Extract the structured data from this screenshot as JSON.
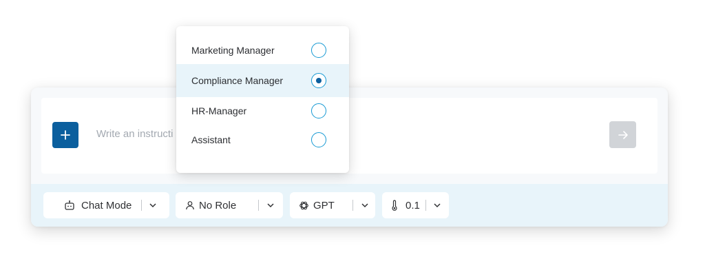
{
  "composer": {
    "placeholder": "Write an instructi",
    "add_icon": "plus-icon",
    "send_icon": "arrow-right-icon"
  },
  "toolbar": {
    "mode": {
      "label": "Chat Mode",
      "icon": "robot-icon"
    },
    "role": {
      "label": "No Role",
      "icon": "user-icon"
    },
    "model": {
      "label": "GPT",
      "icon": "openai-icon"
    },
    "temperature": {
      "label": "0.1",
      "icon": "thermometer-icon"
    }
  },
  "role_menu": {
    "options": [
      {
        "label": "Marketing Manager",
        "selected": false
      },
      {
        "label": "Compliance Manager",
        "selected": true
      },
      {
        "label": "HR-Manager",
        "selected": false
      },
      {
        "label": "Assistant",
        "selected": false
      }
    ]
  },
  "colors": {
    "accent": "#0b5f9e",
    "radio_border": "#1599d3",
    "toolbar_bg": "#e8f4fa",
    "send_disabled": "#d1d4d8"
  }
}
